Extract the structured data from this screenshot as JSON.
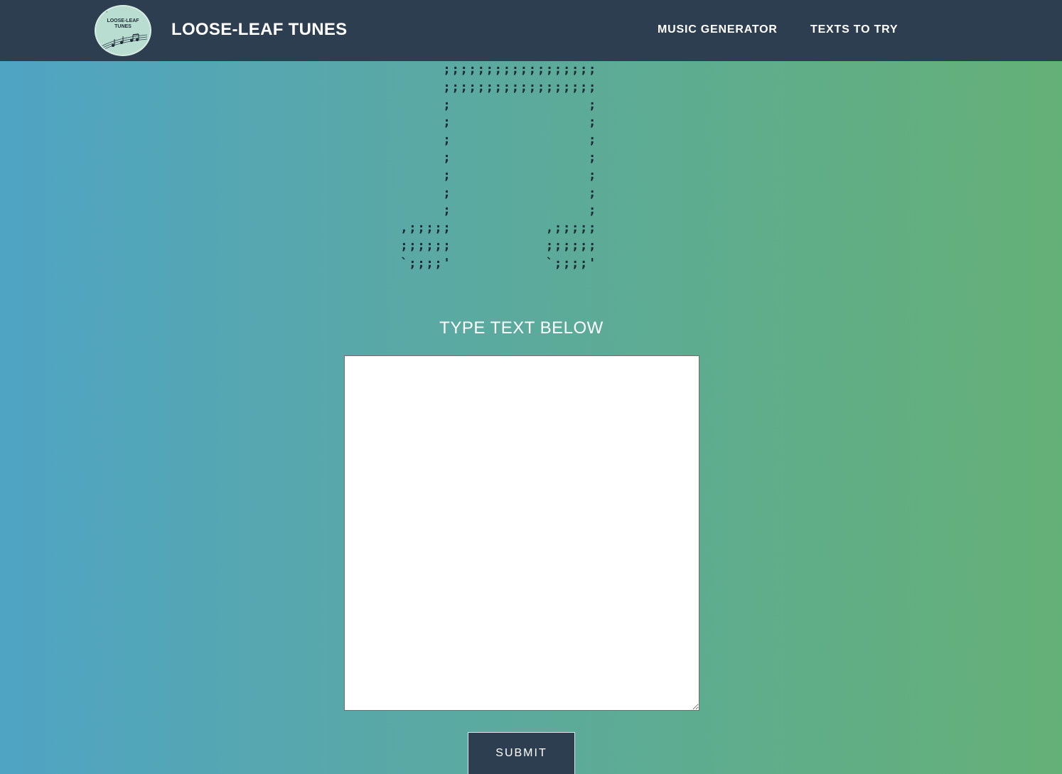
{
  "header": {
    "logo_text_line1": "LOOSE-LEAF",
    "logo_text_line2": "TUNES",
    "brand": "LOOSE-LEAF TUNES",
    "nav": [
      {
        "label": "MUSIC GENERATOR"
      },
      {
        "label": "TEXTS TO TRY"
      }
    ]
  },
  "main": {
    "ascii_art": "     ;;;;;;;;;;;;;;;;;;\n     ;;;;;;;;;;;;;;;;;;\n     ;                ;\n     ;                ;\n     ;                ;\n     ;                ;\n     ;                ;\n     ;                ;\n     ;                ;\n,;;;;;           ,;;;;;\n;;;;;;           ;;;;;;\n`;;;;'           `;;;;'",
    "prompt_label": "TYPE TEXT BELOW",
    "textarea_value": "",
    "submit_label": "SUBMIT"
  },
  "colors": {
    "navbar": "#2d3e50",
    "gradient_start": "#4fa4c4",
    "gradient_end": "#65b077",
    "ascii": "#1e2a35"
  }
}
